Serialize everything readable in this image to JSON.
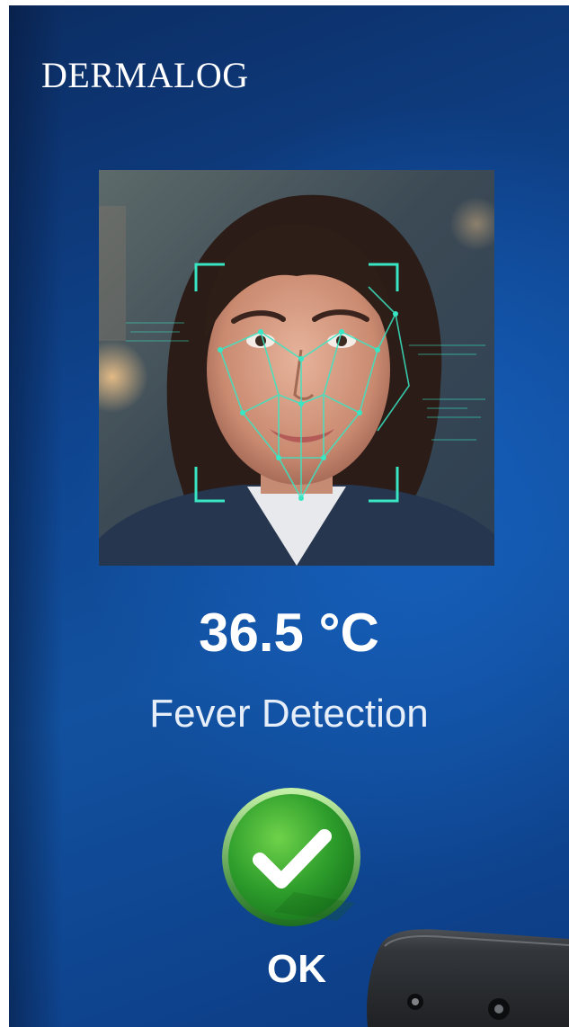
{
  "brand": {
    "name": "DERMALOG"
  },
  "scan": {
    "photo_icon": "face-scan-photo",
    "temperature": "36.5 °C",
    "label": "Fever Detection"
  },
  "result": {
    "icon": "checkmark-icon",
    "text": "OK",
    "color": "#2e9e2c"
  },
  "device_icon": "camera-device",
  "colors": {
    "background_dark": "#0c2d63",
    "background_light": "#1660be",
    "overlay_accent": "#39e6c3"
  }
}
